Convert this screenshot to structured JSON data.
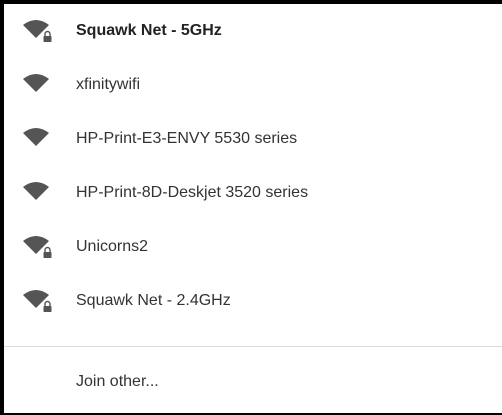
{
  "networks": [
    {
      "name": "Squawk Net - 5GHz",
      "secured": true,
      "connected": true,
      "icon": "wifi-locked-icon"
    },
    {
      "name": "xfinitywifi",
      "secured": false,
      "connected": false,
      "icon": "wifi-icon"
    },
    {
      "name": "HP-Print-E3-ENVY 5530 series",
      "secured": false,
      "connected": false,
      "icon": "wifi-icon"
    },
    {
      "name": "HP-Print-8D-Deskjet 3520 series",
      "secured": false,
      "connected": false,
      "icon": "wifi-icon"
    },
    {
      "name": "Unicorns2",
      "secured": true,
      "connected": false,
      "icon": "wifi-locked-icon"
    },
    {
      "name": "Squawk Net - 2.4GHz",
      "secured": true,
      "connected": false,
      "icon": "wifi-locked-icon"
    }
  ],
  "join_other": {
    "label": "Join other..."
  },
  "colors": {
    "icon": "#555555",
    "text": "#333333",
    "divider": "#dcdcdc",
    "background": "#ffffff",
    "frame": "#000000"
  }
}
